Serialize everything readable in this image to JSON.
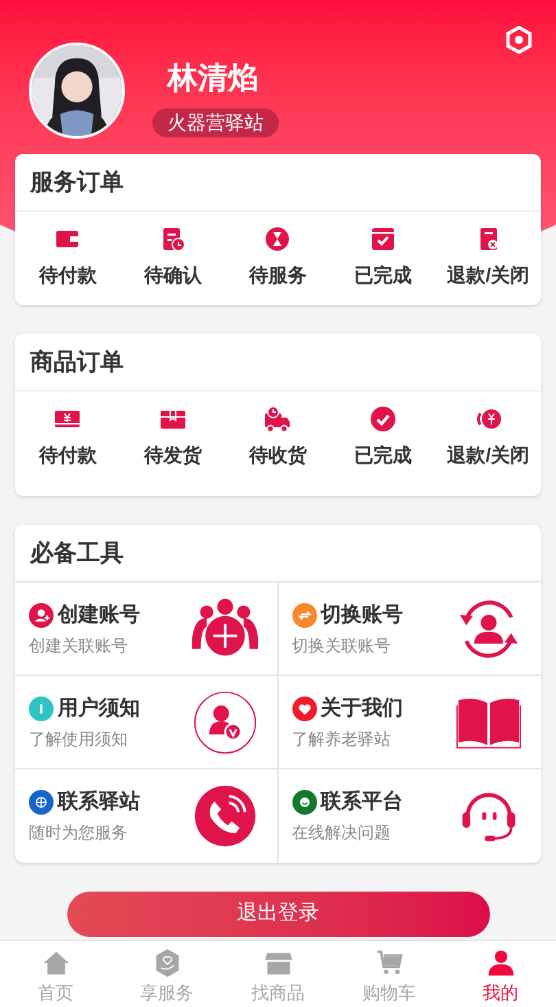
{
  "profile": {
    "name": "林清焰",
    "tag": "火器营驿站"
  },
  "service_orders": {
    "title": "服务订单",
    "items": [
      {
        "label": "待付款"
      },
      {
        "label": "待确认"
      },
      {
        "label": "待服务"
      },
      {
        "label": "已完成"
      },
      {
        "label": "退款/关闭"
      }
    ]
  },
  "goods_orders": {
    "title": "商品订单",
    "items": [
      {
        "label": "待付款"
      },
      {
        "label": "待发货"
      },
      {
        "label": "待收货"
      },
      {
        "label": "已完成"
      },
      {
        "label": "退款/关闭"
      }
    ]
  },
  "tools": {
    "title": "必备工具",
    "items": [
      {
        "title": "创建账号",
        "subtitle": "创建关联账号",
        "color": "#e0134a"
      },
      {
        "title": "切换账号",
        "subtitle": "切换关联账号",
        "color": "#f7892c"
      },
      {
        "title": "用户须知",
        "subtitle": "了解使用须知",
        "color": "#2ec4c4"
      },
      {
        "title": "关于我们",
        "subtitle": "了解养老驿站",
        "color": "#f01a2a"
      },
      {
        "title": "联系驿站",
        "subtitle": "随时为您服务",
        "color": "#1565c8"
      },
      {
        "title": "联系平台",
        "subtitle": "在线解决问题",
        "color": "#117a2c"
      }
    ]
  },
  "logout_button": "退出登录",
  "tab_bar": [
    {
      "label": "首页",
      "selected": false
    },
    {
      "label": "享服务",
      "selected": false
    },
    {
      "label": "找商品",
      "selected": false
    },
    {
      "label": "购物车",
      "selected": false
    },
    {
      "label": "我的",
      "selected": true
    }
  ]
}
